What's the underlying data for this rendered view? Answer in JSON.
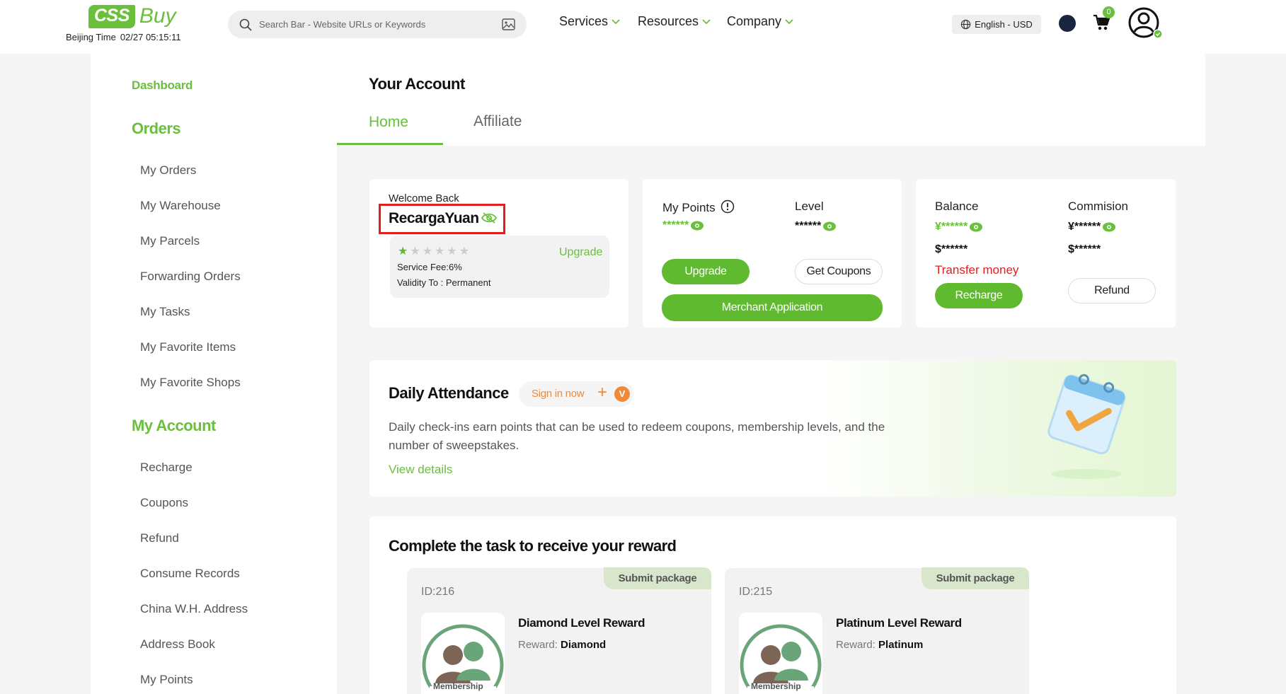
{
  "header": {
    "logo_badge": "CSS",
    "logo_word": "Buy",
    "time_label": "Beijing Time",
    "time_value": "02/27 05:15:11",
    "search_placeholder": "Search Bar - Website URLs or Keywords",
    "nav": [
      "Services",
      "Resources",
      "Company"
    ],
    "language": "English - USD",
    "cart_count": "0"
  },
  "sidebar": {
    "dashboard": "Dashboard",
    "orders_title": "Orders",
    "orders_items": [
      "My Orders",
      "My Warehouse",
      "My Parcels",
      "Forwarding Orders",
      "My Tasks",
      "My Favorite Items",
      "My Favorite Shops"
    ],
    "account_title": "My Account",
    "account_items": [
      "Recharge",
      "Coupons",
      "Refund",
      "Consume Records",
      "China W.H. Address",
      "Address Book",
      "My Points"
    ]
  },
  "main": {
    "title": "Your Account",
    "tabs": [
      "Home",
      "Affiliate"
    ]
  },
  "welcome": {
    "label": "Welcome Back",
    "username": "RecargaYuan",
    "upgrade_link": "Upgrade",
    "service_fee": "Service Fee:6%",
    "validity": "Validity To : Permanent",
    "stars_filled": 1,
    "stars_total": 6
  },
  "points": {
    "my_points_label": "My Points",
    "level_label": "Level",
    "points_mask": "******",
    "level_mask": "******",
    "upgrade_btn": "Upgrade",
    "coupons_btn": "Get Coupons",
    "merchant_btn": "Merchant Application"
  },
  "balance": {
    "balance_label": "Balance",
    "commission_label": "Commision",
    "balance_cny": "¥******",
    "balance_usd": "$******",
    "commission_cny": "¥******",
    "commission_usd": "$******",
    "transfer": "Transfer money",
    "recharge_btn": "Recharge",
    "refund_btn": "Refund"
  },
  "attendance": {
    "title": "Daily Attendance",
    "sign_in": "Sign in now",
    "plus": "+",
    "v_badge": "V",
    "description_line1": "Daily check-ins earn points that can be used to redeem coupons, membership levels, and the",
    "description_line2": "number of sweepstakes.",
    "view_details": "View details"
  },
  "tasks": {
    "title": "Complete the task to receive your reward",
    "cards": [
      {
        "tag": "Submit package",
        "id": "ID:216",
        "name": "Diamond Level Reward",
        "reward_label": "Reward:",
        "reward_value": "Diamond",
        "badge": "Membership"
      },
      {
        "tag": "Submit package",
        "id": "ID:215",
        "name": "Platinum Level Reward",
        "reward_label": "Reward:",
        "reward_value": "Platinum",
        "badge": "Membership"
      }
    ]
  },
  "colors": {
    "accent": "#6abf3c",
    "button_green": "#5fba2f",
    "highlight_red": "#e02020",
    "transfer_red": "#e02020",
    "sign_orange": "#ef8a3a"
  }
}
